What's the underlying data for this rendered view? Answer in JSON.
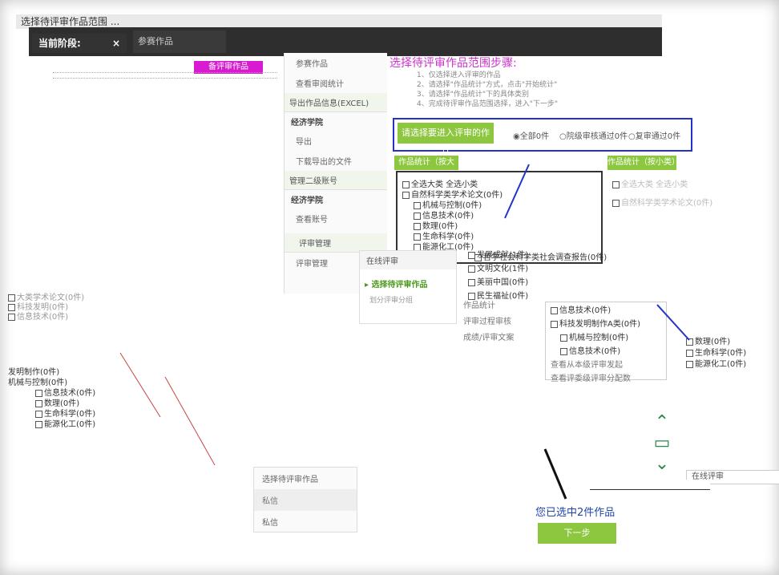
{
  "header": {
    "strip_text": "选择待评审作品范围 ...",
    "stage_label": "当前阶段:",
    "stage_close": "×",
    "sub_tab": "参赛作品",
    "pink_button": "备评审作品"
  },
  "midpanel": {
    "head": "参赛作品",
    "item_stats": "查看审阅统计",
    "export_head": "导出作品信息(EXCEL)",
    "school1": "经济学院",
    "export": "导出",
    "download": "下载导出的文件",
    "manage_head": "管理二级账号",
    "school2": "经济学院",
    "view_account": "查看账号",
    "review_head": "评审管理",
    "review_manage": "评审管理"
  },
  "main": {
    "title": "选择待评审作品范围步骤:",
    "steps": [
      "1、仅选择进入评审的作品",
      "2、请选择\"作品统计\"方式，点击\"开始统计\"",
      "3、请选择\"作品统计\"下的具体类别",
      "4、完成待评审作品范围选择，进入\"下一步\""
    ],
    "filter_label": "请选择要进入评审的作品",
    "radios": [
      "全部0件",
      "院级审核通过0件",
      "复审通过0件"
    ],
    "stats_big": "作品统计（按大类）",
    "stats_small": "作品统计（按小类）",
    "tree": [
      "全选大类  全选小类",
      "自然科学类学术论文(0件)",
      "机械与控制(0件)",
      "信息技术(0件)",
      "数理(0件)",
      "生命科学(0件)",
      "能源化工(0件)",
      "哲学社会科学类社会调查报告(0件)"
    ],
    "list_mid": [
      "发展成就(1件)",
      "文明文化(1件)",
      "美丽中国(0件)",
      "民生福祉(0件)"
    ],
    "misc_links": [
      "作品统计",
      "评审过程审核",
      "成绩/评审文案"
    ],
    "popup": [
      "信息技术(0件)",
      "科技发明制作A类(0件)",
      "机械与控制(0件)",
      "信息技术(0件)",
      "查看从本级评审发起",
      "查看评委级评审分配数"
    ],
    "sub2": [
      "数理(0件)",
      "生命科学(0件)",
      "能源化工(0件)"
    ],
    "left_block": [
      "发明制作(0件)",
      "机械与控制(0件)",
      "信息技术(0件)",
      "数理(0件)",
      "生命科学(0件)",
      "能源化工(0件)"
    ],
    "left_gray": [
      "大类学术论文(0件)",
      "科技发明(0件)",
      "信息技术(0件)"
    ],
    "selected_text": "您已选中2件作品",
    "next_button": "下一步"
  },
  "review": {
    "head": "在线评审",
    "selected": "选择待评审作品",
    "sub": "划分评审分组"
  },
  "online_label": "在线评审",
  "bottom_panel": {
    "title": "选择待评审作品",
    "messages": "私信",
    "message_item": "私信"
  },
  "colors": {
    "accent_green": "#8dc73f",
    "title_pink": "#cc33cc",
    "filter_border": "#2233cc",
    "pink_button": "#d81bd0"
  }
}
